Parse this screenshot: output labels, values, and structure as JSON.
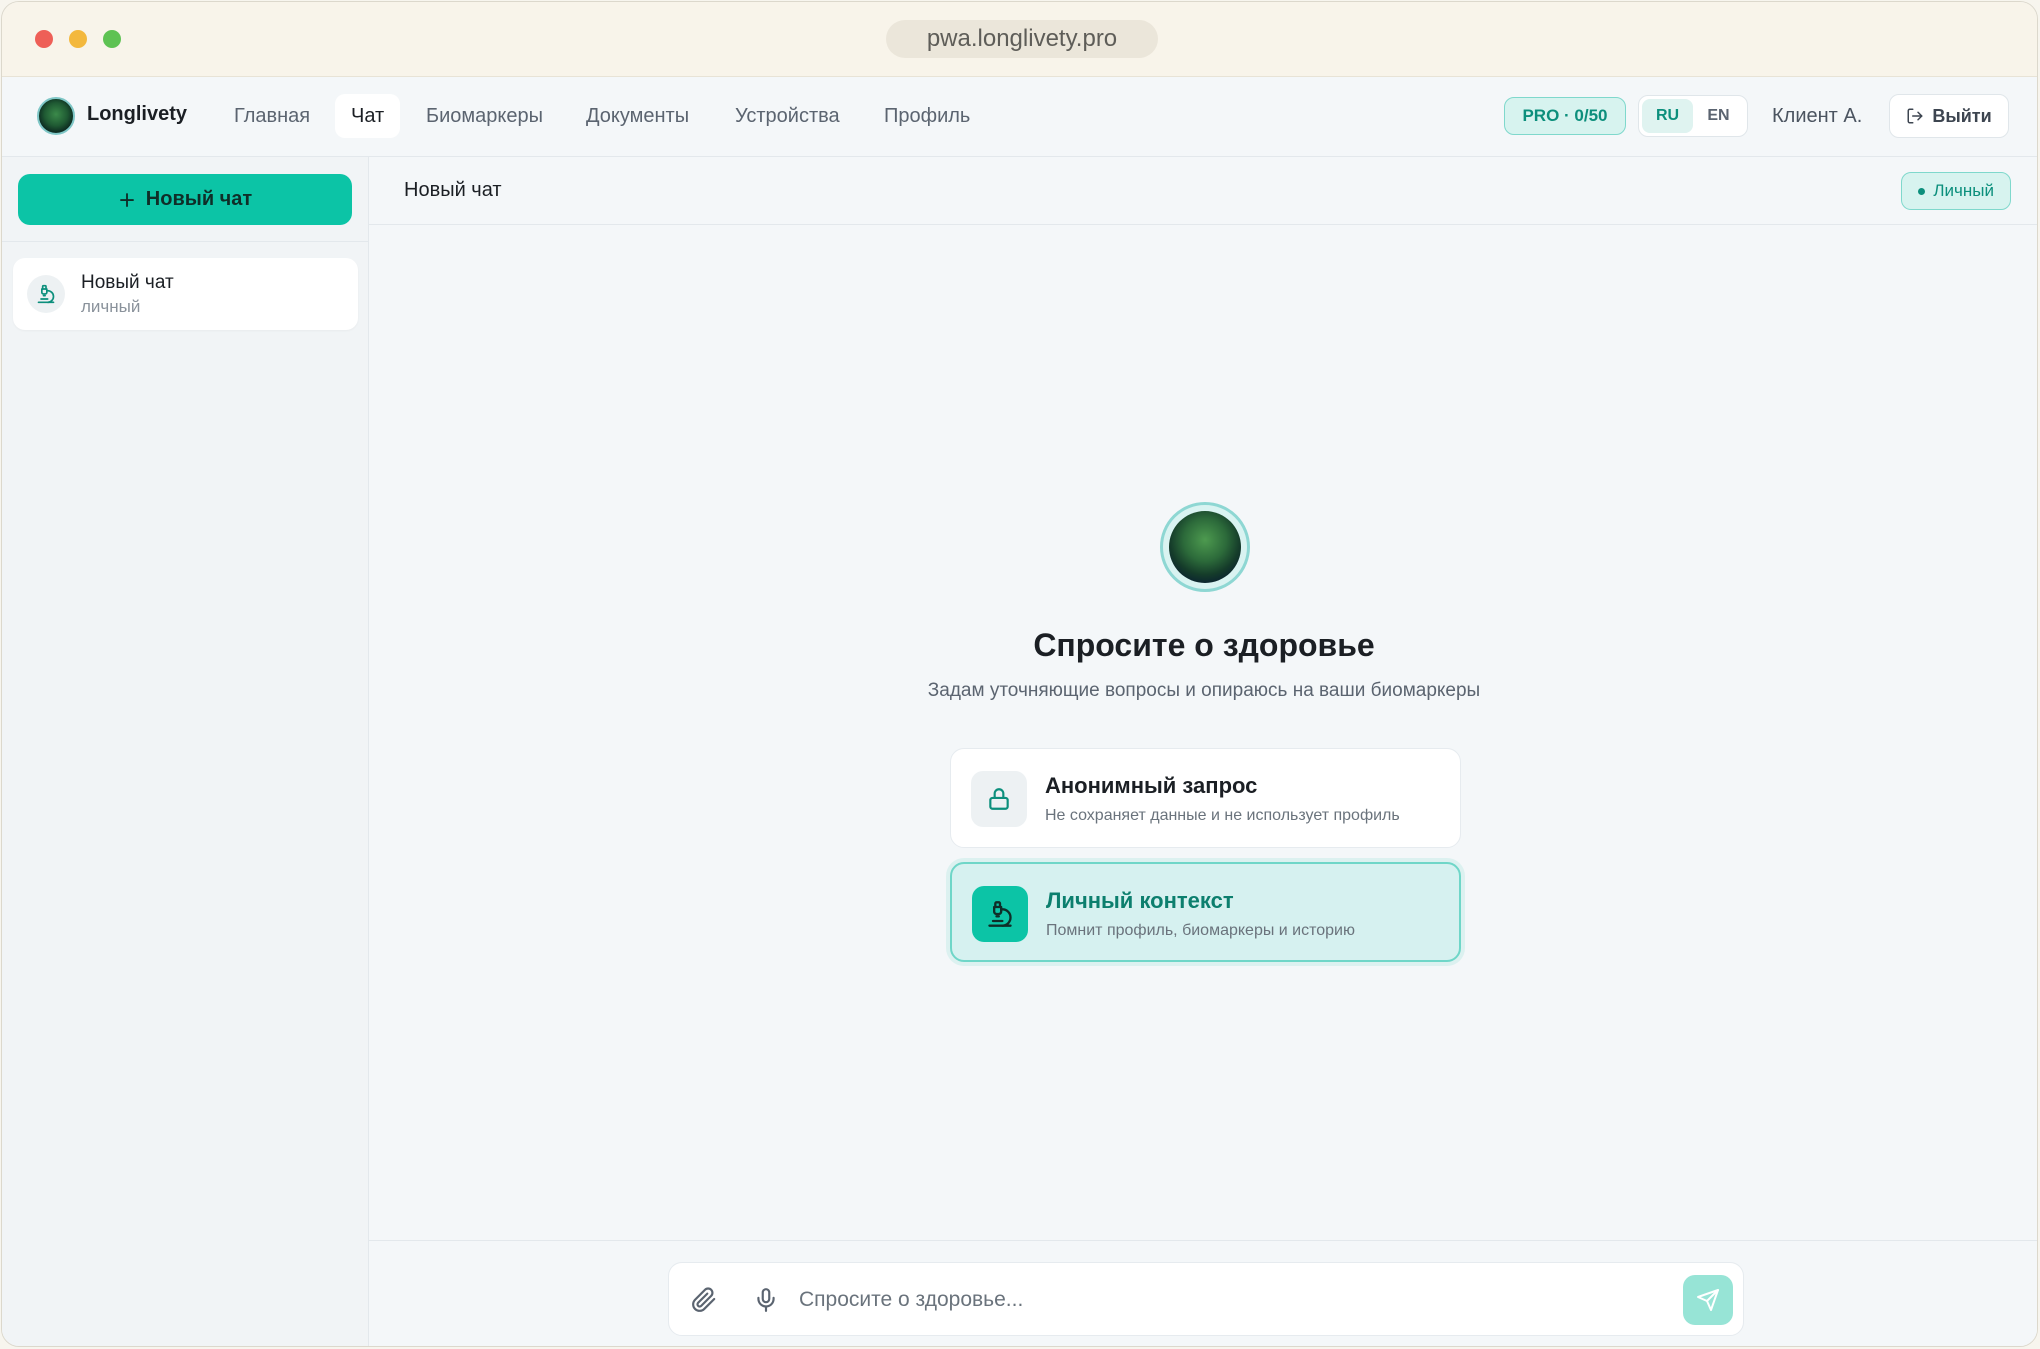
{
  "browser": {
    "url": "pwa.longlivety.pro"
  },
  "app": {
    "name": "Longlivety"
  },
  "nav": {
    "items": [
      {
        "label": "Главная"
      },
      {
        "label": "Чат"
      },
      {
        "label": "Биомаркеры"
      },
      {
        "label": "Документы"
      },
      {
        "label": "Устройства"
      },
      {
        "label": "Профиль"
      }
    ],
    "active": "Чат"
  },
  "header": {
    "plan_badge": "PRO · 0/50",
    "languages": [
      "RU",
      "EN"
    ],
    "active_language": "RU",
    "user_name": "Клиент А.",
    "logout_label": "Выйти"
  },
  "sidebar": {
    "new_chat_label": "Новый чат",
    "chats": [
      {
        "title": "Новый чат",
        "mode": "личный"
      }
    ]
  },
  "main": {
    "title": "Новый чат",
    "mode_badge": "Личный",
    "hero_title": "Спросите о здоровье",
    "hero_subtitle": "Задам уточняющие вопросы и опираюсь на ваши биомаркеры",
    "options": [
      {
        "title": "Анонимный запрос",
        "description": "Не сохраняет данные и не использует профиль",
        "icon": "lock-icon",
        "selected": false
      },
      {
        "title": "Личный контекст",
        "description": "Помнит профиль, биомаркеры и историю",
        "icon": "microscope-icon",
        "selected": true
      }
    ],
    "composer": {
      "placeholder": "Спросите о здоровье...",
      "value": ""
    }
  },
  "colors": {
    "accent": "#0cc4a6",
    "accent_dark": "#0c8f7c",
    "accent_soft": "#d7f3ef",
    "background": "#f4f7f9"
  }
}
